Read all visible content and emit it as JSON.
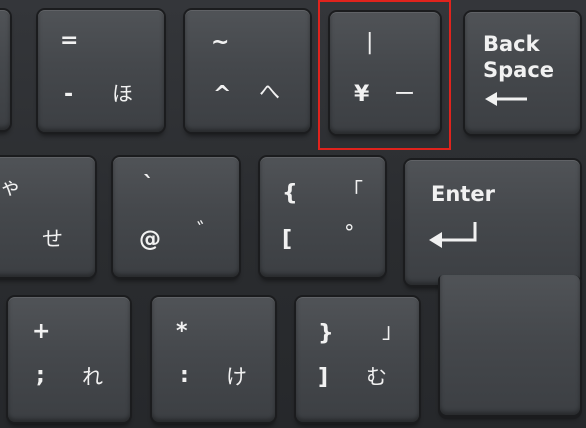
{
  "keys": {
    "minus_ho": {
      "top": "=",
      "bottom_left": "-",
      "bottom_right": "ほ"
    },
    "caret_he": {
      "top": "~",
      "bottom_left": "^",
      "bottom_right": "へ"
    },
    "yen": {
      "top": "|",
      "bottom_left": "¥",
      "bottom_right": "ー"
    },
    "backspace": {
      "line1": "Back",
      "line2": "Space",
      "icon": "left-arrow-icon"
    },
    "row2_left": {
      "top": "ゃ",
      "bottom_right": "せ"
    },
    "at": {
      "top": "`",
      "bottom_left": "@",
      "bottom_right": "゛"
    },
    "bracket_open": {
      "top_left": "{",
      "top_right": "「",
      "bottom_left": "[",
      "bottom_right": "°"
    },
    "enter": {
      "label": "Enter",
      "icon": "return-arrow-icon"
    },
    "semicolon": {
      "top": "+",
      "bottom_left": ";",
      "bottom_right": "れ"
    },
    "colon": {
      "top": "*",
      "bottom_left": ":",
      "bottom_right": "け"
    },
    "bracket_close": {
      "top_left": "}",
      "top_right": "」",
      "bottom_left": "]",
      "bottom_right": "む"
    }
  },
  "colors": {
    "highlight": "#e0231d",
    "keycap": "#45484c",
    "legend": "#f1f1f1"
  }
}
